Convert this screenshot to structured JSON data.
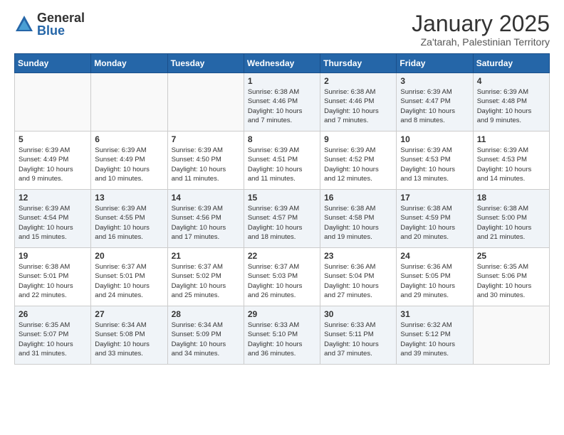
{
  "header": {
    "logo_general": "General",
    "logo_blue": "Blue",
    "month_title": "January 2025",
    "location": "Za'tarah, Palestinian Territory"
  },
  "days_of_week": [
    "Sunday",
    "Monday",
    "Tuesday",
    "Wednesday",
    "Thursday",
    "Friday",
    "Saturday"
  ],
  "weeks": [
    [
      {
        "day": "",
        "info": ""
      },
      {
        "day": "",
        "info": ""
      },
      {
        "day": "",
        "info": ""
      },
      {
        "day": "1",
        "info": "Sunrise: 6:38 AM\nSunset: 4:46 PM\nDaylight: 10 hours\nand 7 minutes."
      },
      {
        "day": "2",
        "info": "Sunrise: 6:38 AM\nSunset: 4:46 PM\nDaylight: 10 hours\nand 7 minutes."
      },
      {
        "day": "3",
        "info": "Sunrise: 6:39 AM\nSunset: 4:47 PM\nDaylight: 10 hours\nand 8 minutes."
      },
      {
        "day": "4",
        "info": "Sunrise: 6:39 AM\nSunset: 4:48 PM\nDaylight: 10 hours\nand 9 minutes."
      }
    ],
    [
      {
        "day": "5",
        "info": "Sunrise: 6:39 AM\nSunset: 4:49 PM\nDaylight: 10 hours\nand 9 minutes."
      },
      {
        "day": "6",
        "info": "Sunrise: 6:39 AM\nSunset: 4:49 PM\nDaylight: 10 hours\nand 10 minutes."
      },
      {
        "day": "7",
        "info": "Sunrise: 6:39 AM\nSunset: 4:50 PM\nDaylight: 10 hours\nand 11 minutes."
      },
      {
        "day": "8",
        "info": "Sunrise: 6:39 AM\nSunset: 4:51 PM\nDaylight: 10 hours\nand 11 minutes."
      },
      {
        "day": "9",
        "info": "Sunrise: 6:39 AM\nSunset: 4:52 PM\nDaylight: 10 hours\nand 12 minutes."
      },
      {
        "day": "10",
        "info": "Sunrise: 6:39 AM\nSunset: 4:53 PM\nDaylight: 10 hours\nand 13 minutes."
      },
      {
        "day": "11",
        "info": "Sunrise: 6:39 AM\nSunset: 4:53 PM\nDaylight: 10 hours\nand 14 minutes."
      }
    ],
    [
      {
        "day": "12",
        "info": "Sunrise: 6:39 AM\nSunset: 4:54 PM\nDaylight: 10 hours\nand 15 minutes."
      },
      {
        "day": "13",
        "info": "Sunrise: 6:39 AM\nSunset: 4:55 PM\nDaylight: 10 hours\nand 16 minutes."
      },
      {
        "day": "14",
        "info": "Sunrise: 6:39 AM\nSunset: 4:56 PM\nDaylight: 10 hours\nand 17 minutes."
      },
      {
        "day": "15",
        "info": "Sunrise: 6:39 AM\nSunset: 4:57 PM\nDaylight: 10 hours\nand 18 minutes."
      },
      {
        "day": "16",
        "info": "Sunrise: 6:38 AM\nSunset: 4:58 PM\nDaylight: 10 hours\nand 19 minutes."
      },
      {
        "day": "17",
        "info": "Sunrise: 6:38 AM\nSunset: 4:59 PM\nDaylight: 10 hours\nand 20 minutes."
      },
      {
        "day": "18",
        "info": "Sunrise: 6:38 AM\nSunset: 5:00 PM\nDaylight: 10 hours\nand 21 minutes."
      }
    ],
    [
      {
        "day": "19",
        "info": "Sunrise: 6:38 AM\nSunset: 5:01 PM\nDaylight: 10 hours\nand 22 minutes."
      },
      {
        "day": "20",
        "info": "Sunrise: 6:37 AM\nSunset: 5:01 PM\nDaylight: 10 hours\nand 24 minutes."
      },
      {
        "day": "21",
        "info": "Sunrise: 6:37 AM\nSunset: 5:02 PM\nDaylight: 10 hours\nand 25 minutes."
      },
      {
        "day": "22",
        "info": "Sunrise: 6:37 AM\nSunset: 5:03 PM\nDaylight: 10 hours\nand 26 minutes."
      },
      {
        "day": "23",
        "info": "Sunrise: 6:36 AM\nSunset: 5:04 PM\nDaylight: 10 hours\nand 27 minutes."
      },
      {
        "day": "24",
        "info": "Sunrise: 6:36 AM\nSunset: 5:05 PM\nDaylight: 10 hours\nand 29 minutes."
      },
      {
        "day": "25",
        "info": "Sunrise: 6:35 AM\nSunset: 5:06 PM\nDaylight: 10 hours\nand 30 minutes."
      }
    ],
    [
      {
        "day": "26",
        "info": "Sunrise: 6:35 AM\nSunset: 5:07 PM\nDaylight: 10 hours\nand 31 minutes."
      },
      {
        "day": "27",
        "info": "Sunrise: 6:34 AM\nSunset: 5:08 PM\nDaylight: 10 hours\nand 33 minutes."
      },
      {
        "day": "28",
        "info": "Sunrise: 6:34 AM\nSunset: 5:09 PM\nDaylight: 10 hours\nand 34 minutes."
      },
      {
        "day": "29",
        "info": "Sunrise: 6:33 AM\nSunset: 5:10 PM\nDaylight: 10 hours\nand 36 minutes."
      },
      {
        "day": "30",
        "info": "Sunrise: 6:33 AM\nSunset: 5:11 PM\nDaylight: 10 hours\nand 37 minutes."
      },
      {
        "day": "31",
        "info": "Sunrise: 6:32 AM\nSunset: 5:12 PM\nDaylight: 10 hours\nand 39 minutes."
      },
      {
        "day": "",
        "info": ""
      }
    ]
  ]
}
